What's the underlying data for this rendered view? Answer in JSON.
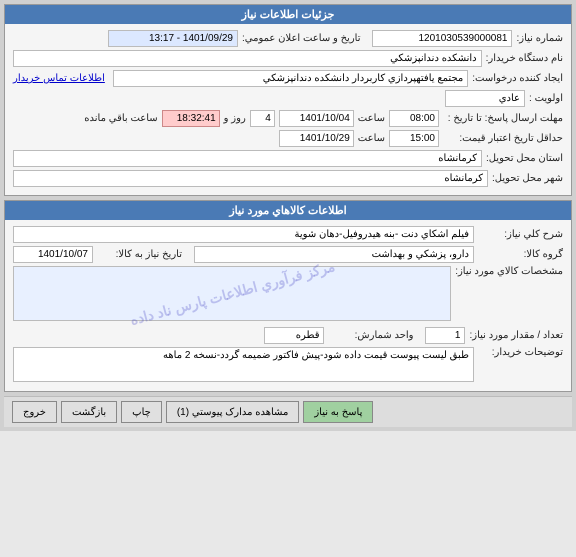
{
  "page": {
    "title": "جزئيات اطلاعات نياز"
  },
  "header_section": {
    "title": "جزئيات اطلاعات نياز",
    "fields": {
      "order_number_label": "شماره نياز:",
      "order_number_value": "1201030539000081",
      "date_label": "تاريخ و ساعت اعلان عمومي:",
      "date_value": "1401/09/29 - 13:17",
      "buyer_name_label": "نام دستگاه خريدار:",
      "buyer_name_value": "دانشکده دندانپزشکي",
      "request_creation_label": "ايجاد کننده درخواست:",
      "request_creation_value": "مجتمع يافتهپردازي کاربردار دانشکده دندانپزشکي",
      "buyer_contact_link": "اطلاعات تماس خريدار",
      "priority_label": "اولويت :",
      "priority_value": "عادي",
      "send_date_label": "مهلت ارسال پاسخ: تا تاريخ :",
      "send_time1": "08:00",
      "send_date1": "1401/10/04",
      "send_day_label": "روز و",
      "send_day_value": "4",
      "send_time_remain": "18:32:41",
      "send_remain_label": "ساعت باقي مانده",
      "validity_label": "حداقل تاريخ اعتبار قيمت:",
      "validity_time": "15:00",
      "validity_date": "1401/10/29",
      "province_label": "استان محل تحويل:",
      "province_value": "کرمانشاه",
      "city_label": "شهر محل تحويل:",
      "city_value": "کرمانشاه"
    }
  },
  "goods_section": {
    "title": "اطلاعات کالاهاي مورد نياز",
    "fields": {
      "description_label": "شرح کلي نياز:",
      "description_value": "فيلم اشکاي دنت -بنه هيدروفيل-دهان شوية",
      "group_label": "گروه کالا:",
      "group_value": "دارو، پزشکي و بهداشت",
      "date_need_label": "تاريخ نياز به کالا:",
      "date_need_value": "1401/10/07",
      "specs_label": "مشخصات کالاي مورد نياز:",
      "qty_label": "تعداد / مقدار مورد نياز:",
      "qty_value": "1",
      "unit_label": "واحد شمارش:",
      "unit_value": "قطره",
      "notes_label": "توضيحات خريدار:",
      "notes_value": "طبق ليست پيوست قيمت داده شود-پيش فاکتور ضميمه گردد-نسخه 2 ماهه"
    },
    "watermark": "مرکز فرآوري اطلاعات پارس ناد داده"
  },
  "buttons": {
    "exit_label": "خروج",
    "back_label": "بازگشت",
    "print_label": "چاپ",
    "view_docs_label": "مشاهده مدارک پيوستي (1)",
    "submit_label": "پاسخ به نياز"
  }
}
